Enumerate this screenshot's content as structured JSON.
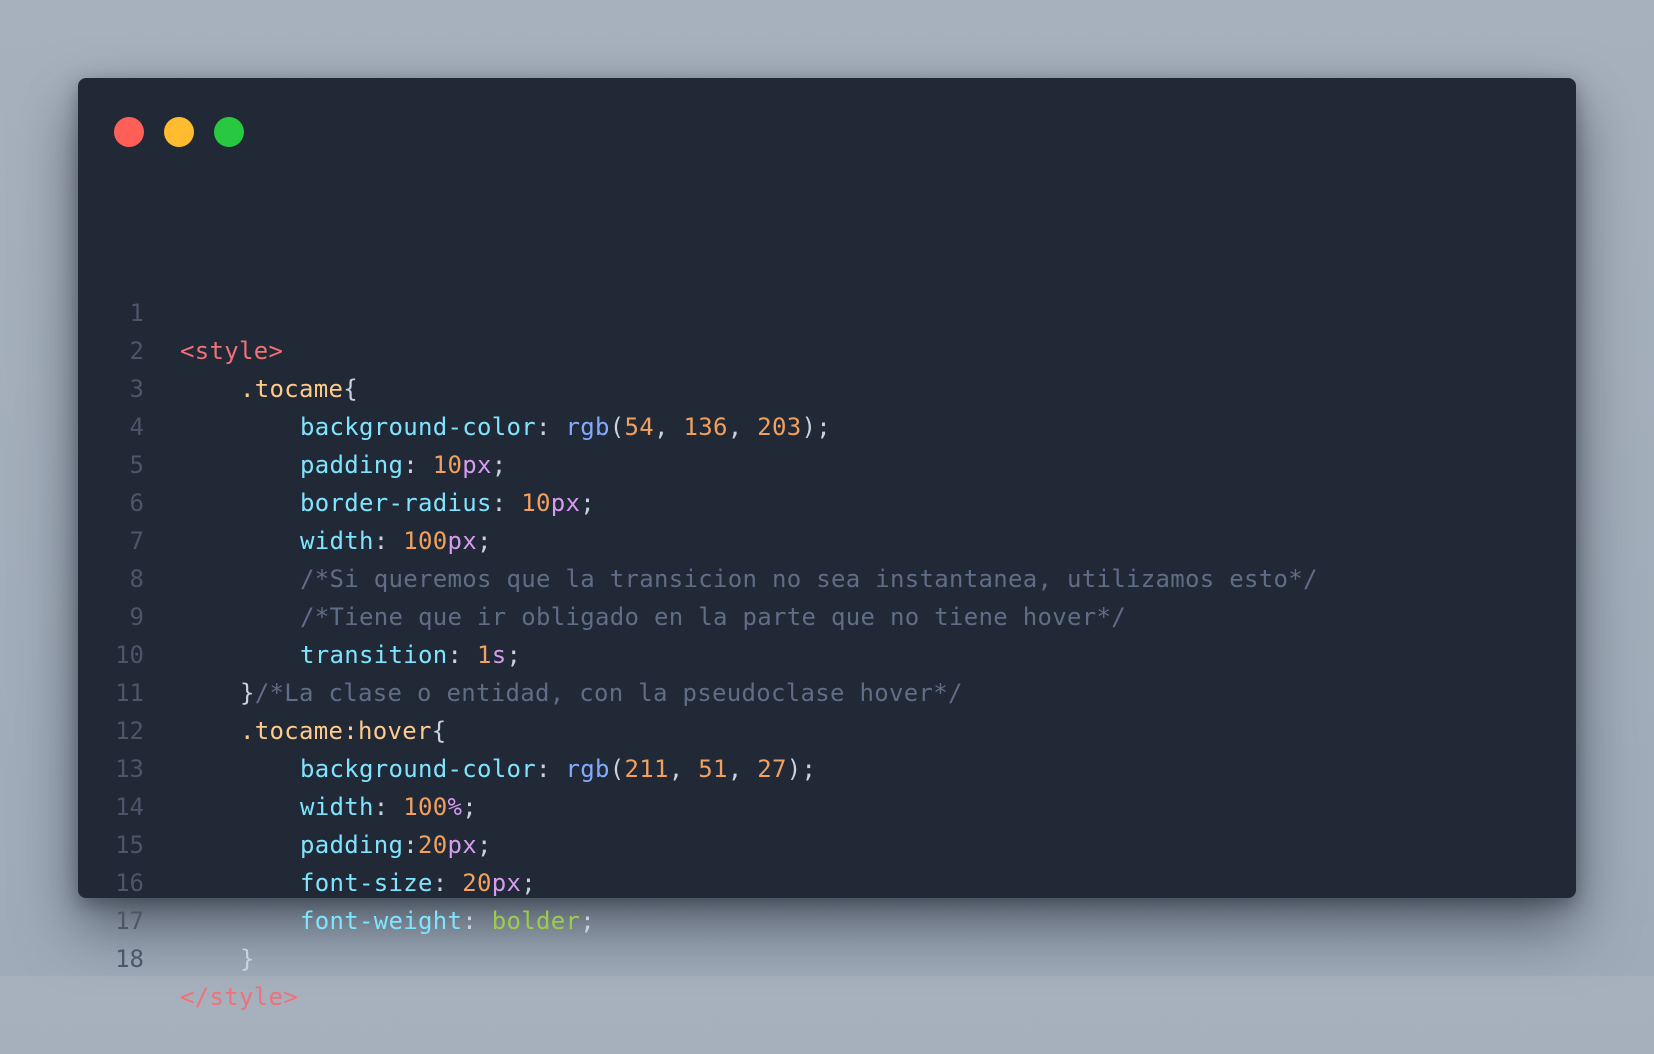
{
  "window": {
    "controls": {
      "close_color": "#ff5f57",
      "minimize_color": "#febc2e",
      "maximize_color": "#28c840"
    }
  },
  "code": {
    "lines": [
      {
        "n": "1",
        "tokens": [
          {
            "t": "<style>",
            "c": "tag"
          }
        ]
      },
      {
        "n": "2",
        "tokens": [
          {
            "t": ".tocame",
            "c": "sel"
          },
          {
            "t": "{",
            "c": "punc"
          }
        ]
      },
      {
        "n": "3",
        "tokens": [
          {
            "t": "background-color",
            "c": "prop"
          },
          {
            "t": ": ",
            "c": "punc"
          },
          {
            "t": "rgb",
            "c": "fn"
          },
          {
            "t": "(",
            "c": "punc"
          },
          {
            "t": "54",
            "c": "num"
          },
          {
            "t": ", ",
            "c": "punc"
          },
          {
            "t": "136",
            "c": "num"
          },
          {
            "t": ", ",
            "c": "punc"
          },
          {
            "t": "203",
            "c": "num"
          },
          {
            "t": ");",
            "c": "punc"
          }
        ]
      },
      {
        "n": "4",
        "tokens": [
          {
            "t": "padding",
            "c": "prop"
          },
          {
            "t": ": ",
            "c": "punc"
          },
          {
            "t": "10",
            "c": "num"
          },
          {
            "t": "px",
            "c": "unit"
          },
          {
            "t": ";",
            "c": "punc"
          }
        ]
      },
      {
        "n": "5",
        "tokens": [
          {
            "t": "border-radius",
            "c": "prop"
          },
          {
            "t": ": ",
            "c": "punc"
          },
          {
            "t": "10",
            "c": "num"
          },
          {
            "t": "px",
            "c": "unit"
          },
          {
            "t": ";",
            "c": "punc"
          }
        ]
      },
      {
        "n": "6",
        "tokens": [
          {
            "t": "width",
            "c": "prop"
          },
          {
            "t": ": ",
            "c": "punc"
          },
          {
            "t": "100",
            "c": "num"
          },
          {
            "t": "px",
            "c": "unit"
          },
          {
            "t": ";",
            "c": "punc"
          }
        ]
      },
      {
        "n": "7",
        "tokens": [
          {
            "t": "/*Si queremos que la transicion no sea instantanea, utilizamos esto*/",
            "c": "cmt"
          }
        ]
      },
      {
        "n": "8",
        "tokens": [
          {
            "t": "/*Tiene que ir obligado en la parte que no tiene hover*/",
            "c": "cmt"
          }
        ]
      },
      {
        "n": "9",
        "tokens": [
          {
            "t": "transition",
            "c": "prop"
          },
          {
            "t": ": ",
            "c": "punc"
          },
          {
            "t": "1",
            "c": "num"
          },
          {
            "t": "s",
            "c": "unit"
          },
          {
            "t": ";",
            "c": "punc"
          }
        ]
      },
      {
        "n": "10",
        "tokens": [
          {
            "t": "}",
            "c": "punc"
          },
          {
            "t": "/*La clase o entidad, con la pseudoclase hover*/",
            "c": "cmt"
          }
        ]
      },
      {
        "n": "11",
        "tokens": [
          {
            "t": ".tocame:hover",
            "c": "sel"
          },
          {
            "t": "{",
            "c": "punc"
          }
        ]
      },
      {
        "n": "12",
        "tokens": [
          {
            "t": "background-color",
            "c": "prop"
          },
          {
            "t": ": ",
            "c": "punc"
          },
          {
            "t": "rgb",
            "c": "fn"
          },
          {
            "t": "(",
            "c": "punc"
          },
          {
            "t": "211",
            "c": "num"
          },
          {
            "t": ", ",
            "c": "punc"
          },
          {
            "t": "51",
            "c": "num"
          },
          {
            "t": ", ",
            "c": "punc"
          },
          {
            "t": "27",
            "c": "num"
          },
          {
            "t": ");",
            "c": "punc"
          }
        ]
      },
      {
        "n": "13",
        "tokens": [
          {
            "t": "width",
            "c": "prop"
          },
          {
            "t": ": ",
            "c": "punc"
          },
          {
            "t": "100",
            "c": "num"
          },
          {
            "t": "%",
            "c": "unit"
          },
          {
            "t": ";",
            "c": "punc"
          }
        ]
      },
      {
        "n": "14",
        "tokens": [
          {
            "t": "padding",
            "c": "prop"
          },
          {
            "t": ":",
            "c": "punc"
          },
          {
            "t": "20",
            "c": "num"
          },
          {
            "t": "px",
            "c": "unit"
          },
          {
            "t": ";",
            "c": "punc"
          }
        ]
      },
      {
        "n": "15",
        "tokens": [
          {
            "t": "font-size",
            "c": "prop"
          },
          {
            "t": ": ",
            "c": "punc"
          },
          {
            "t": "20",
            "c": "num"
          },
          {
            "t": "px",
            "c": "unit"
          },
          {
            "t": ";",
            "c": "punc"
          }
        ]
      },
      {
        "n": "16",
        "tokens": [
          {
            "t": "font-weight",
            "c": "prop"
          },
          {
            "t": ": ",
            "c": "punc"
          },
          {
            "t": "bolder",
            "c": "kw"
          },
          {
            "t": ";",
            "c": "punc"
          }
        ]
      },
      {
        "n": "17",
        "tokens": [
          {
            "t": "}",
            "c": "punc"
          }
        ]
      },
      {
        "n": "18",
        "tokens": [
          {
            "t": "</style>",
            "c": "tag"
          }
        ]
      }
    ]
  }
}
